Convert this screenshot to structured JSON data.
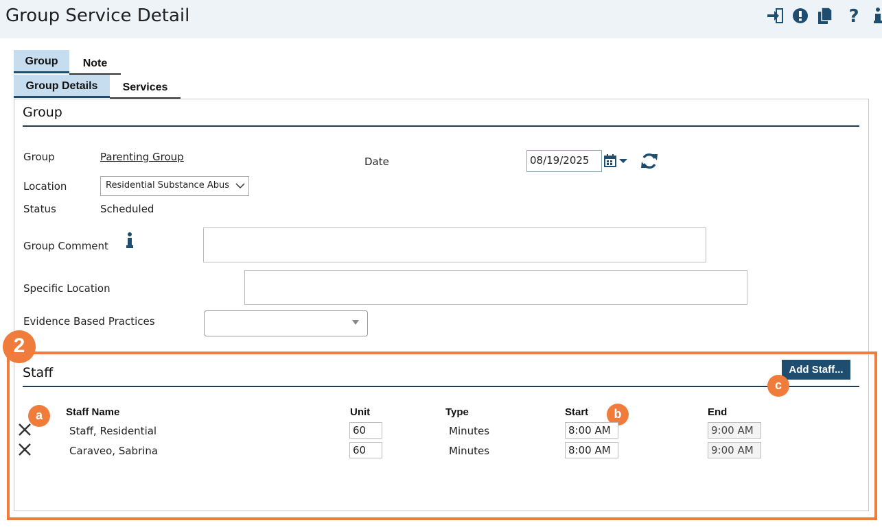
{
  "header": {
    "title": "Group Service Detail"
  },
  "toolbar": {
    "icons": [
      "sign-in-icon",
      "alert-icon",
      "copy-icon",
      "help-icon",
      "info-icon"
    ]
  },
  "tabs": {
    "level1": [
      {
        "label": "Group",
        "active": true
      },
      {
        "label": "Note",
        "active": false
      }
    ],
    "level2": [
      {
        "label": "Group Details",
        "active": true
      },
      {
        "label": "Services",
        "active": false
      }
    ]
  },
  "group_section": {
    "title": "Group",
    "group_label": "Group",
    "group_value": "Parenting Group",
    "date_label": "Date",
    "date_value": "08/19/2025",
    "location_label": "Location",
    "location_value": "Residential Substance Abus",
    "status_label": "Status",
    "status_value": "Scheduled",
    "comment_label": "Group Comment",
    "specific_location_label": "Specific Location",
    "ebp_label": "Evidence Based Practices"
  },
  "annotations": {
    "section_badge": "2",
    "badge_a": "a",
    "badge_b": "b",
    "badge_c": "c"
  },
  "staff_section": {
    "title": "Staff",
    "add_button": "Add Staff...",
    "columns": {
      "name": "Staff Name",
      "unit": "Unit",
      "type": "Type",
      "start": "Start",
      "end": "End"
    },
    "rows": [
      {
        "name": "Staff, Residential",
        "unit": "60",
        "type": "Minutes",
        "start": "8:00 AM",
        "end": "9:00 AM"
      },
      {
        "name": "Caraveo, Sabrina",
        "unit": "60",
        "type": "Minutes",
        "start": "8:00 AM",
        "end": "9:00 AM"
      }
    ]
  },
  "colors": {
    "accent": "#1e4d70",
    "annotation": "#f07c3c",
    "tab_active_bg": "#c6ddef",
    "topbar_bg": "#eef3f8"
  }
}
